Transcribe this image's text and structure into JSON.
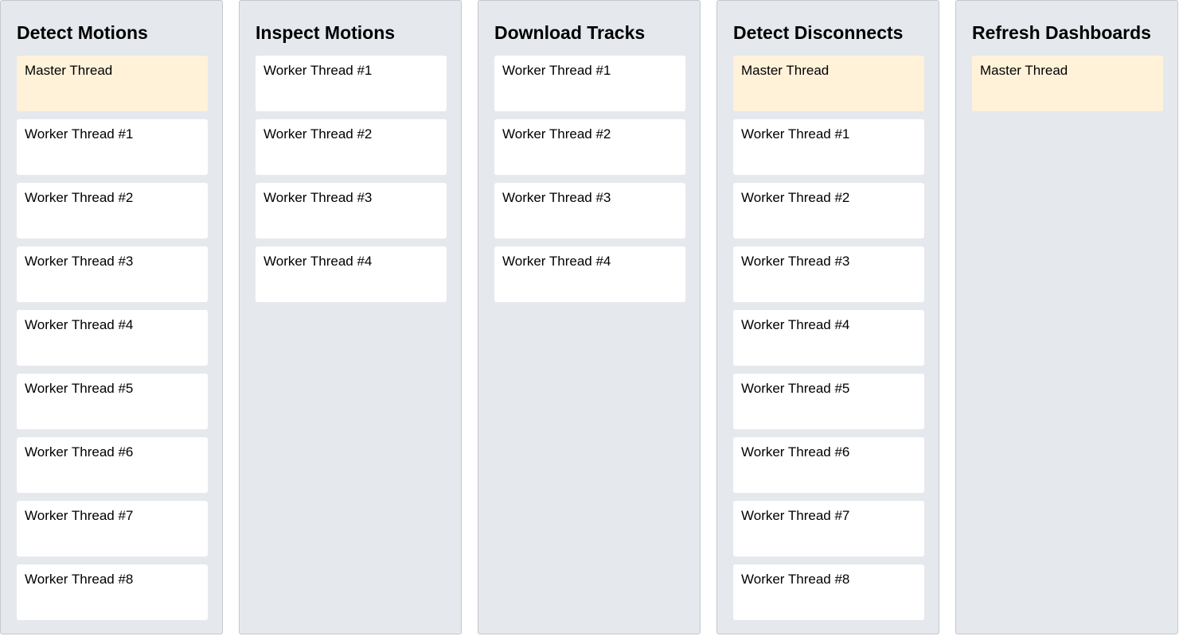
{
  "columns": [
    {
      "title": "Detect Motions",
      "cards": [
        {
          "label": "Master Thread",
          "kind": "master"
        },
        {
          "label": "Worker Thread #1",
          "kind": "worker"
        },
        {
          "label": "Worker Thread #2",
          "kind": "worker"
        },
        {
          "label": "Worker Thread #3",
          "kind": "worker"
        },
        {
          "label": "Worker Thread #4",
          "kind": "worker"
        },
        {
          "label": "Worker Thread #5",
          "kind": "worker"
        },
        {
          "label": "Worker Thread #6",
          "kind": "worker"
        },
        {
          "label": "Worker Thread #7",
          "kind": "worker"
        },
        {
          "label": "Worker Thread #8",
          "kind": "worker"
        }
      ]
    },
    {
      "title": "Inspect Motions",
      "cards": [
        {
          "label": "Worker Thread #1",
          "kind": "worker"
        },
        {
          "label": "Worker Thread #2",
          "kind": "worker"
        },
        {
          "label": "Worker Thread #3",
          "kind": "worker"
        },
        {
          "label": "Worker Thread #4",
          "kind": "worker"
        }
      ]
    },
    {
      "title": "Download Tracks",
      "cards": [
        {
          "label": "Worker Thread #1",
          "kind": "worker"
        },
        {
          "label": "Worker Thread #2",
          "kind": "worker"
        },
        {
          "label": "Worker Thread #3",
          "kind": "worker"
        },
        {
          "label": "Worker Thread #4",
          "kind": "worker"
        }
      ]
    },
    {
      "title": "Detect Disconnects",
      "cards": [
        {
          "label": "Master Thread",
          "kind": "master"
        },
        {
          "label": "Worker Thread #1",
          "kind": "worker"
        },
        {
          "label": "Worker Thread #2",
          "kind": "worker"
        },
        {
          "label": "Worker Thread #3",
          "kind": "worker"
        },
        {
          "label": "Worker Thread #4",
          "kind": "worker"
        },
        {
          "label": "Worker Thread #5",
          "kind": "worker"
        },
        {
          "label": "Worker Thread #6",
          "kind": "worker"
        },
        {
          "label": "Worker Thread #7",
          "kind": "worker"
        },
        {
          "label": "Worker Thread #8",
          "kind": "worker"
        }
      ]
    },
    {
      "title": "Refresh Dashboards",
      "cards": [
        {
          "label": "Master Thread",
          "kind": "master"
        }
      ]
    }
  ],
  "colors": {
    "column_background": "#e5e8ed",
    "column_border": "#c3c8cf",
    "worker_card": "#ffffff",
    "master_card": "#fff2d9"
  }
}
